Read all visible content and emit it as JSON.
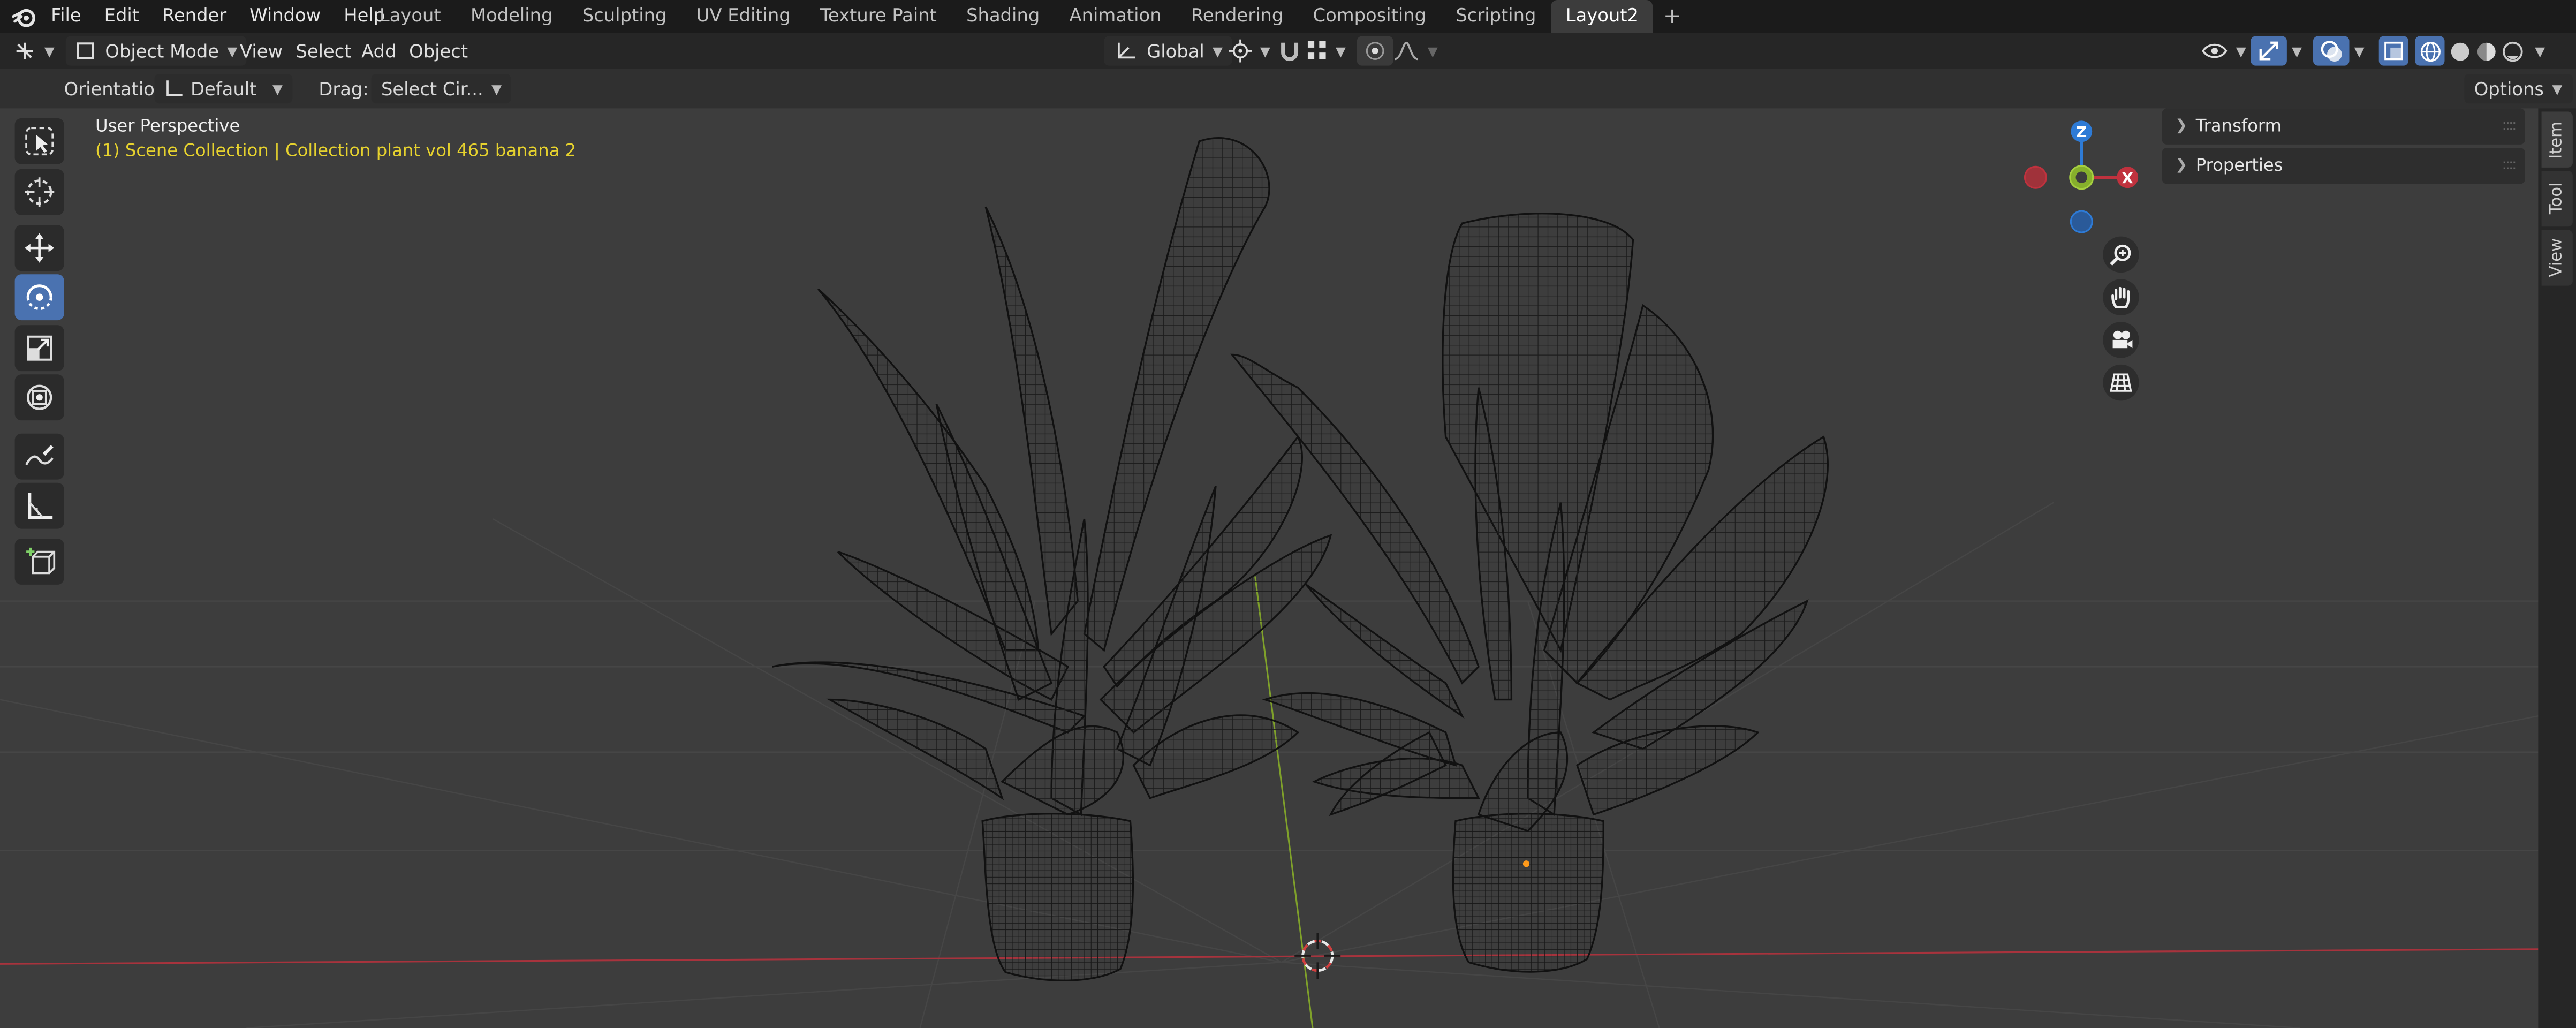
{
  "menu": [
    "File",
    "Edit",
    "Render",
    "Window",
    "Help"
  ],
  "workspace_tabs": [
    "Layout",
    "Modeling",
    "Sculpting",
    "UV Editing",
    "Texture Paint",
    "Shading",
    "Animation",
    "Rendering",
    "Compositing",
    "Scripting",
    "Layout2"
  ],
  "active_tab": "Layout2",
  "header": {
    "mode": "Object Mode",
    "menus": [
      "View",
      "Select",
      "Add",
      "Object"
    ],
    "transform_orientation": "Global"
  },
  "tool_settings": {
    "orientation_label": "Orientation:",
    "orientation_value": "Default",
    "drag_label": "Drag:",
    "drag_value": "Select Cir...",
    "options": "Options"
  },
  "viewport": {
    "view_name": "User Perspective",
    "collection_info": "(1) Scene Collection | Collection plant vol 465 banana 2"
  },
  "gizmo": {
    "z": "Z",
    "x": "X"
  },
  "npanel": {
    "sections": [
      "Transform",
      "Properties"
    ],
    "tabs": [
      "Item",
      "Tool",
      "View"
    ]
  },
  "colors": {
    "accent": "#4a72b0",
    "info_text": "#e6d22e",
    "axis_x": "#c0323e",
    "axis_y": "#86b02c",
    "axis_z": "#2e7bd6"
  },
  "icons": [
    "blender-logo",
    "select-box",
    "cursor",
    "move",
    "rotate",
    "scale",
    "transform",
    "annotate",
    "measure",
    "add-cube",
    "zoom",
    "hand",
    "camera",
    "grid"
  ]
}
